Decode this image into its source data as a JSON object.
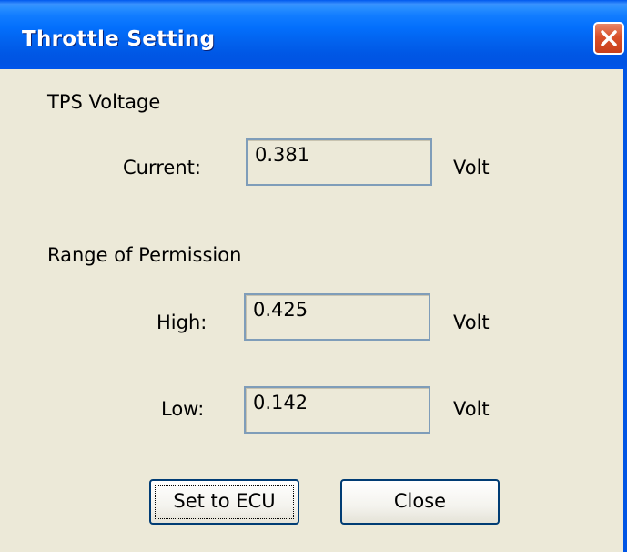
{
  "window": {
    "title": "Throttle Setting"
  },
  "icons": {
    "close": "close-icon"
  },
  "tps_section": {
    "heading": "TPS Voltage",
    "current_label": "Current:",
    "current_value": "0.381",
    "current_unit": "Volt"
  },
  "range_section": {
    "heading": "Range of Permission",
    "high_label": "High:",
    "high_value": "0.425",
    "high_unit": "Volt",
    "low_label": "Low:",
    "low_value": "0.142",
    "low_unit": "Volt"
  },
  "buttons": {
    "set_to_ecu": "Set to ECU",
    "close": "Close"
  },
  "colors": {
    "titlebar": "#0055e5",
    "close_button": "#d9502a",
    "dialog_bg": "#ece9d8"
  }
}
